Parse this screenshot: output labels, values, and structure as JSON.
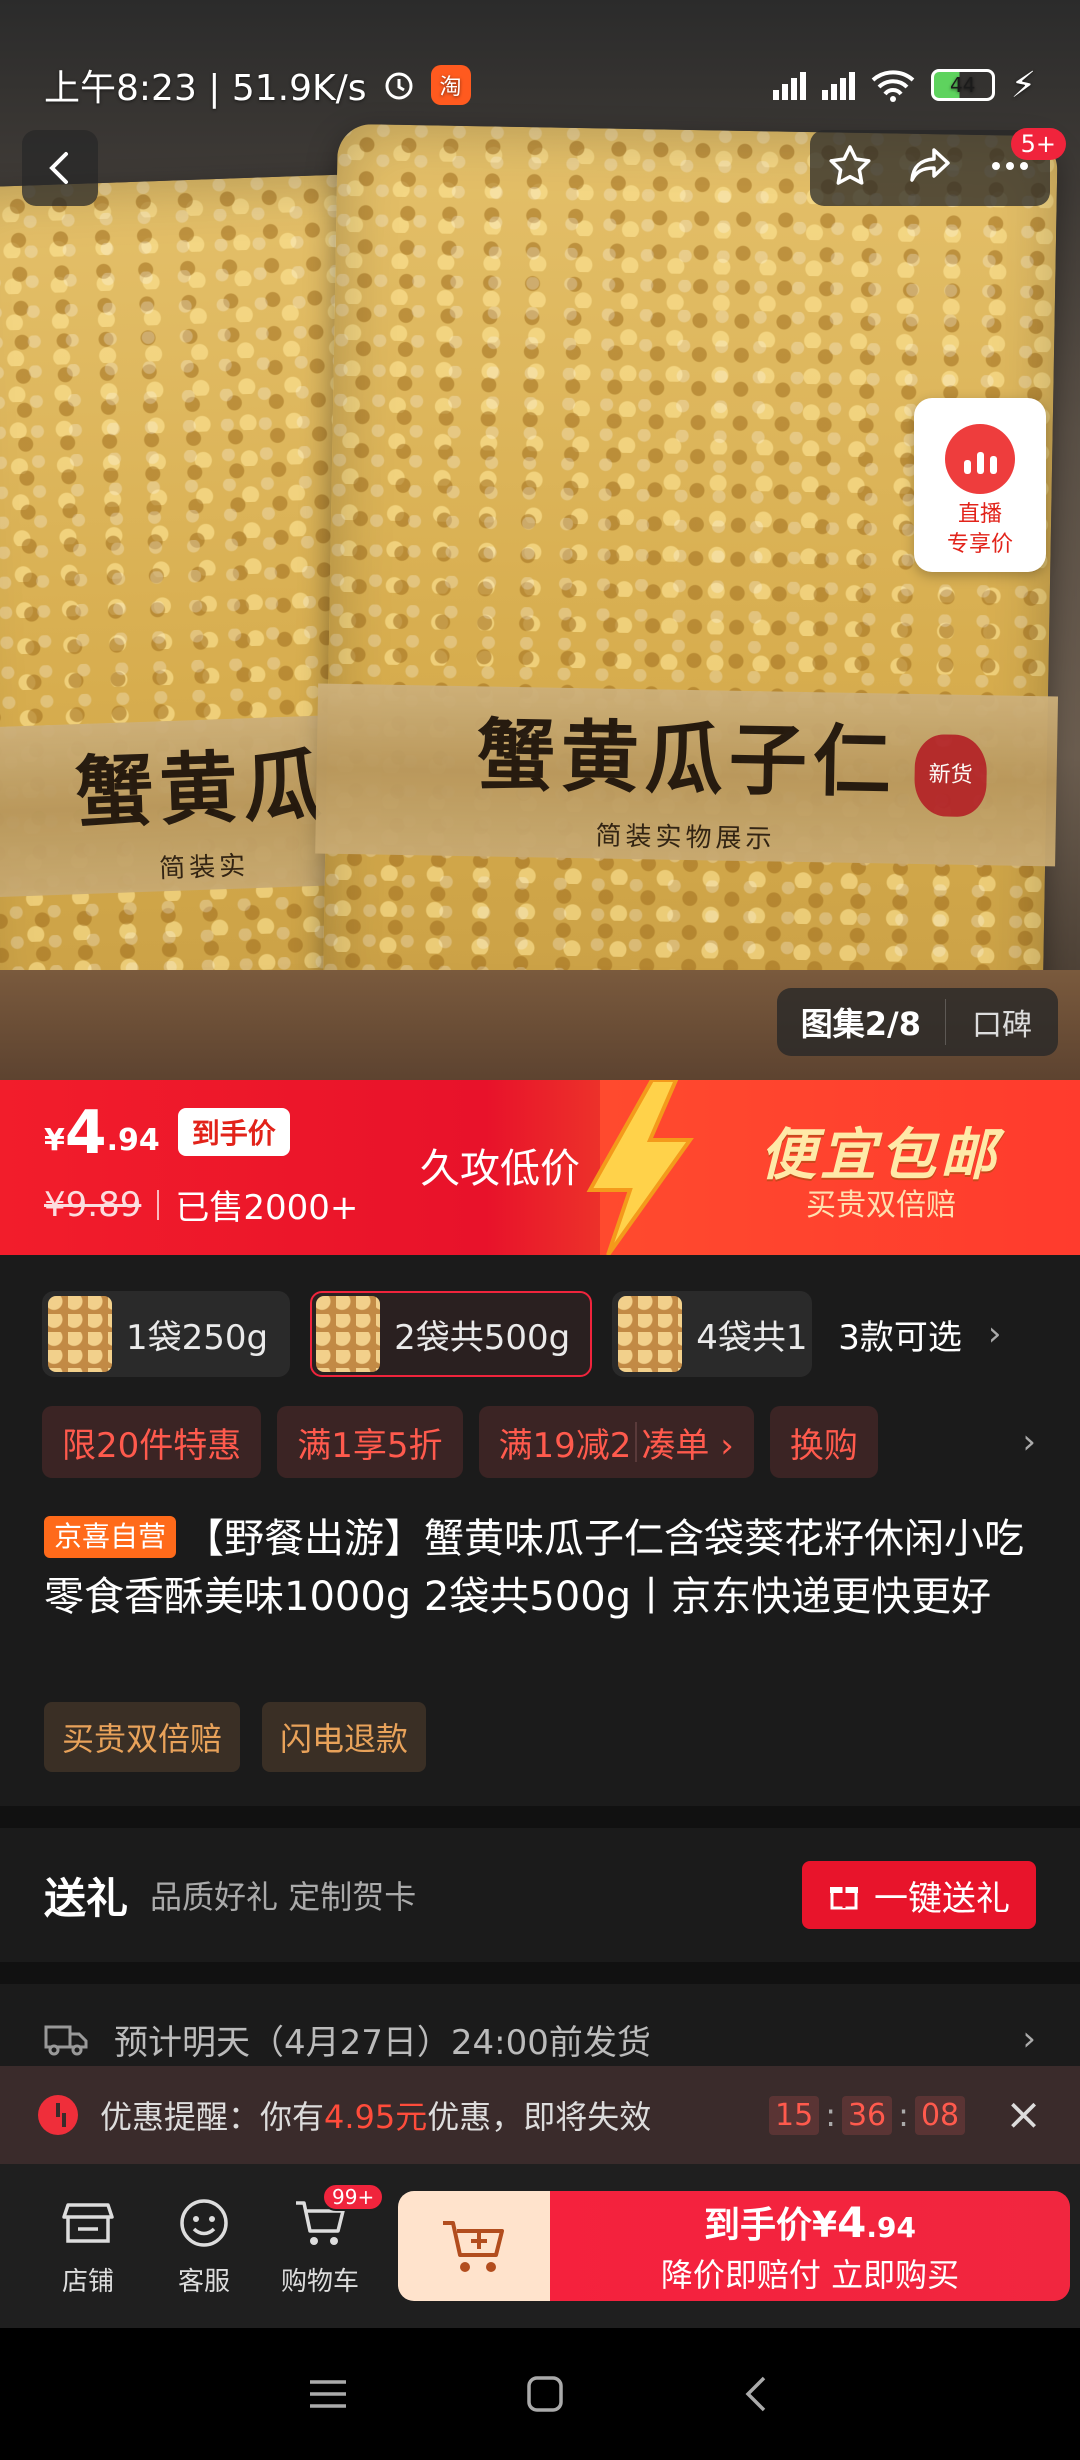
{
  "status_bar": {
    "time_speed": "上午8:23 | 51.9K/s",
    "taobao_icon": "淘",
    "battery": "44"
  },
  "header": {
    "more_badge": "5+"
  },
  "live_card": {
    "label_line1": "直播",
    "label_line2": "专享价"
  },
  "gallery": {
    "counter": "图集2/8",
    "reviews": "口碑"
  },
  "hero_bag": {
    "title_front": "蟹黄瓜子仁",
    "title_back": "蟹黄瓜",
    "subtitle_front": "简装实物展示",
    "subtitle_back": "简装实",
    "seal": "新货"
  },
  "price": {
    "currency": "¥",
    "integer": "4",
    "decimal": ".94",
    "arrive_tag": "到手价",
    "original": "¥9.89",
    "sold": "已售2000+",
    "long_low": "久攻低价",
    "promo_big": "便宜包邮",
    "promo_small": "买贵双倍赔"
  },
  "sku": {
    "items": [
      {
        "name": "1袋250g"
      },
      {
        "name": "2袋共500g"
      },
      {
        "name": "4袋共1"
      }
    ],
    "more": "3款可选"
  },
  "promos": [
    {
      "text": "限20件特惠"
    },
    {
      "text": "满1享5折"
    },
    {
      "text": "满19减2"
    },
    {
      "text": "凑单 ›"
    },
    {
      "text": "换购"
    }
  ],
  "product": {
    "self_tag": "京喜自营",
    "title": "【野餐出游】蟹黄味瓜子仁含袋葵花籽休闲小吃零食香酥美味1000g 2袋共500g丨京东快递更快更好"
  },
  "chips": [
    "买贵双倍赔",
    "闪电退款"
  ],
  "gift": {
    "heading": "送礼",
    "desc": "品质好礼 定制贺卡",
    "button": "一键送礼"
  },
  "shipping": {
    "text": "预计明天（4月27日）24:00前发货"
  },
  "reminder": {
    "prefix": "优惠提醒：你有",
    "amount": "4.95元",
    "suffix": "优惠，即将失效",
    "hh": "15",
    "mm": "36",
    "ss": "08"
  },
  "bottom_bar": {
    "shop": "店铺",
    "service": "客服",
    "cart": "购物车",
    "cart_badge": "99+",
    "buy_line1_prefix": "到手价¥",
    "buy_line1_int": "4",
    "buy_line1_dec": ".94",
    "buy_line2": "降价即赔付 立即购买"
  },
  "colors": {
    "accent": "#e8142b",
    "promo_text": "#ff5a4d",
    "chip_text": "#e8a25a",
    "background": "#1b1b1b"
  }
}
